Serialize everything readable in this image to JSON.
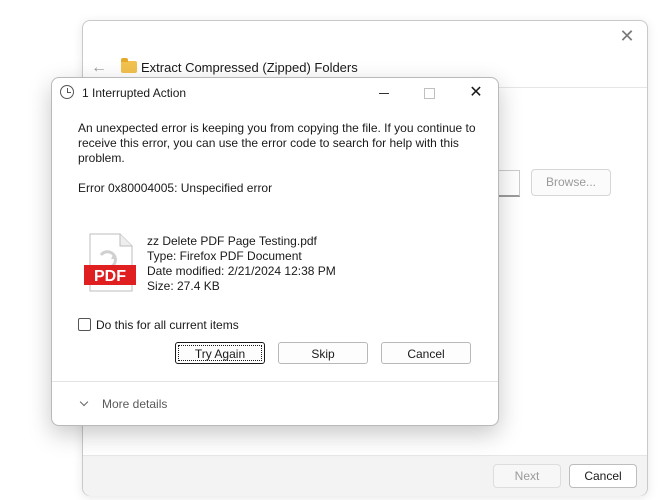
{
  "background_window": {
    "title": "Extract Compressed (Zipped) Folders",
    "close_glyph": "✕",
    "back_glyph": "←",
    "browse_label": "Browse...",
    "next_label": "Next",
    "cancel_label": "Cancel",
    "icons": {
      "back": "arrow-left-icon",
      "folder": "zip-folder-icon",
      "close": "close-icon"
    }
  },
  "dialog": {
    "title": "1 Interrupted Action",
    "close_glyph": "✕",
    "message": "An unexpected error is keeping you from copying the file. If you continue to receive this error, you can use the error code to search for help with this problem.",
    "error_line": "Error 0x80004005: Unspecified error",
    "file": {
      "name": "zz Delete PDF Page Testing.pdf",
      "type": "Type: Firefox PDF Document",
      "modified": "Date modified: 2/21/2024 12:38 PM",
      "size": "Size: 27.4 KB",
      "icon": "pdf-file-icon",
      "icon_text": "PDF",
      "icon_color": "#e02020"
    },
    "checkbox": {
      "label": "Do this for all current items",
      "checked": false
    },
    "buttons": {
      "try_again": "Try Again",
      "skip": "Skip",
      "cancel": "Cancel"
    },
    "more_details": "More details",
    "icons": {
      "title": "clock-icon",
      "minimize": "minimize-icon",
      "maximize": "maximize-icon",
      "close": "close-icon",
      "expand": "chevron-down-icon"
    }
  }
}
